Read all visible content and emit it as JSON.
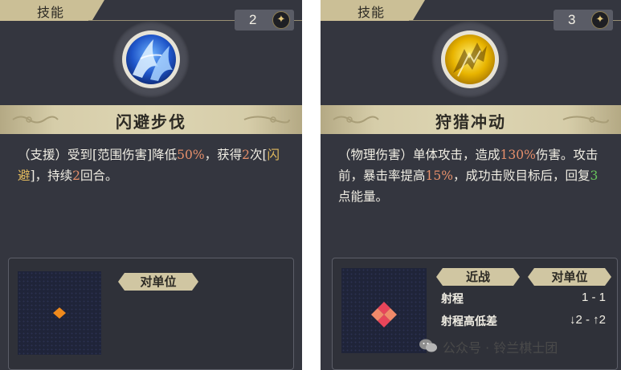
{
  "cards": [
    {
      "header_label": "技能",
      "cost": "2",
      "cost_icon": "star-coin-icon",
      "skill_icon": "blue-dodge-icon",
      "name": "闪避步伐",
      "desc": {
        "p1": "（支援）受到[范围伤害]降低",
        "v1": "50%",
        "p2": "，获得",
        "v2": "2",
        "p3": "次[",
        "kw": "闪避",
        "p4": "]，持续",
        "v3": "2",
        "p5": "回合。"
      },
      "target_label": "对单位",
      "accent_colors": {
        "value": "#e58f6b",
        "number": "#67c45c",
        "keyword": "#e3bb5e"
      }
    },
    {
      "header_label": "技能",
      "cost": "3",
      "cost_icon": "star-coin-icon",
      "skill_icon": "golden-charge-icon",
      "name": "狩猎冲动",
      "desc": {
        "p1": "（物理伤害）单体攻击，造成",
        "v1": "130%",
        "p2": "伤害。攻击前，暴击率提高",
        "v2": "15%",
        "p3": "，成功击败目标后，回复",
        "v3": "3",
        "p4": "点能量。"
      },
      "range_type": "近战",
      "target_label": "对单位",
      "stats": [
        {
          "label": "射程",
          "value": "1 - 1"
        },
        {
          "label": "射程高低差",
          "value": "↓2 - ↑2"
        }
      ]
    }
  ],
  "watermark": {
    "icon": "wechat-icon",
    "text": "公众号 · 铃兰棋士团"
  }
}
